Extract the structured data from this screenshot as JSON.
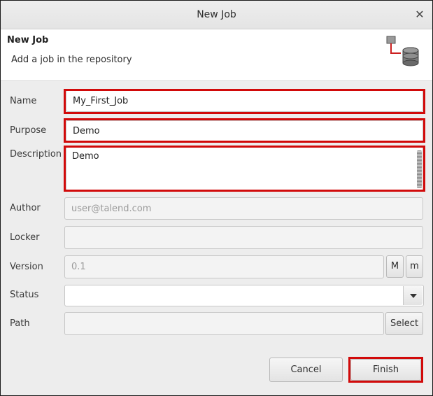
{
  "window": {
    "title": "New Job",
    "close_symbol": "✕"
  },
  "header": {
    "title": "New Job",
    "subtitle": "Add a job in the repository",
    "icon": "job-repository-icon"
  },
  "form": {
    "name": {
      "label": "Name",
      "value": "My_First_Job"
    },
    "purpose": {
      "label": "Purpose",
      "value": "Demo"
    },
    "description": {
      "label": "Description",
      "value": "Demo"
    },
    "author": {
      "label": "Author",
      "placeholder": "user@talend.com"
    },
    "locker": {
      "label": "Locker",
      "value": ""
    },
    "version": {
      "label": "Version",
      "placeholder": "0.1",
      "major_label": "M",
      "minor_label": "m"
    },
    "status": {
      "label": "Status",
      "value": ""
    },
    "path": {
      "label": "Path",
      "value": "",
      "select_label": "Select"
    }
  },
  "buttons": {
    "cancel": "Cancel",
    "finish": "Finish"
  },
  "colors": {
    "highlight": "#d10a0a",
    "background": "#ededed"
  }
}
